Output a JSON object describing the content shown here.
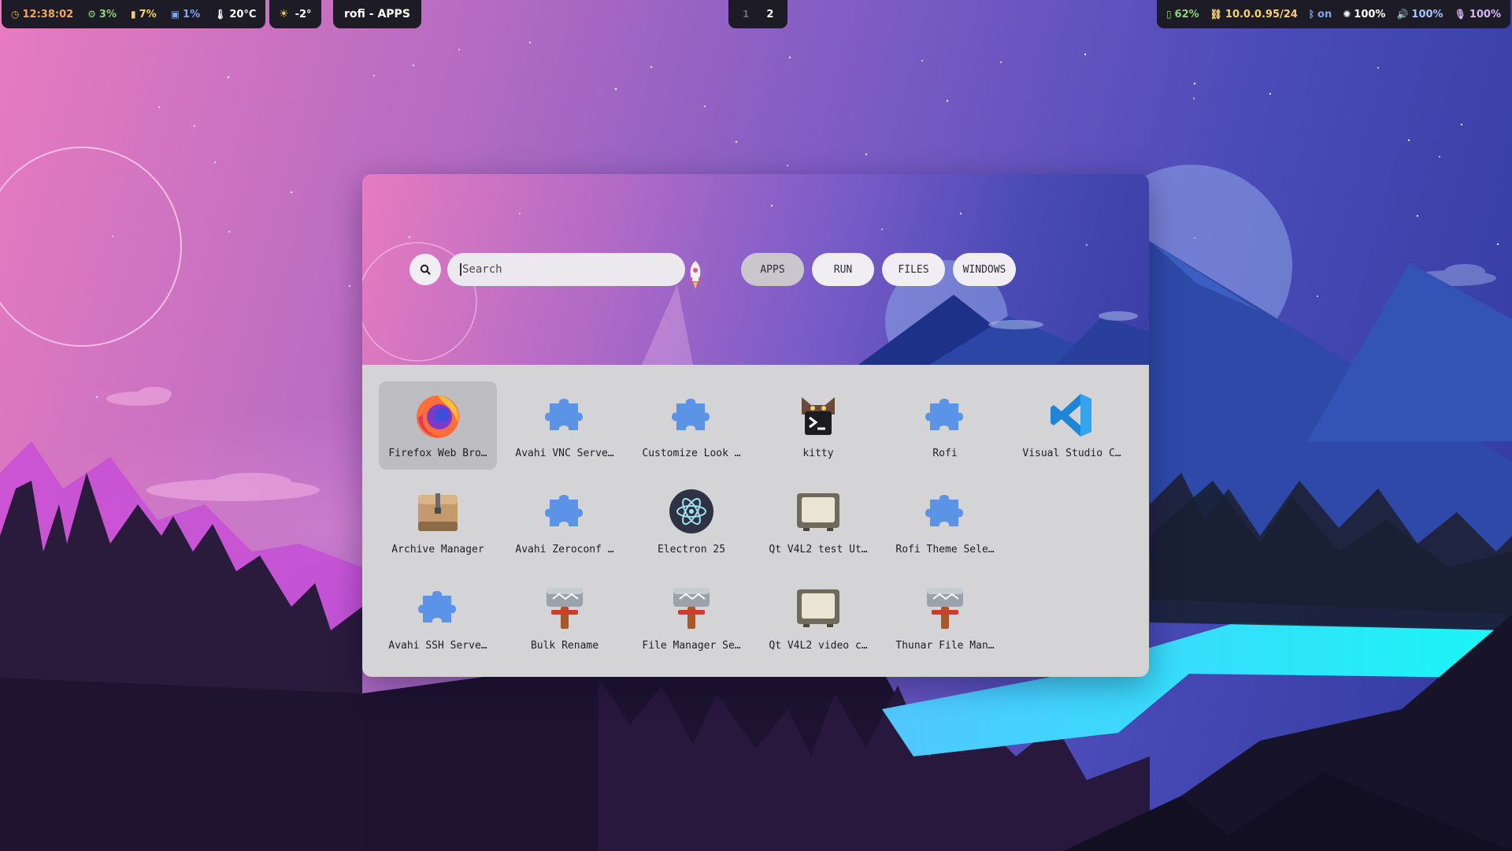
{
  "topbar": {
    "clock": "12:38:02",
    "cpu": "3%",
    "memory": "7%",
    "disk": "1%",
    "temperature": "20°C",
    "weather": "-2°",
    "window_title": "rofi - APPS",
    "workspaces": [
      "1",
      "2"
    ],
    "active_workspace": "2",
    "battery": "62%",
    "network": "10.0.0.95/24",
    "bluetooth": "on",
    "brightness": "100%",
    "volume": "100%",
    "microphone": "100%"
  },
  "rofi": {
    "search": {
      "placeholder": "Search",
      "value": ""
    },
    "modes": [
      {
        "label": "APPS",
        "active": true
      },
      {
        "label": "RUN",
        "active": false
      },
      {
        "label": "FILES",
        "active": false
      },
      {
        "label": "WINDOWS",
        "active": false
      }
    ],
    "apps": [
      {
        "label": "Firefox Web Bro…",
        "icon": "firefox-icon",
        "selected": true
      },
      {
        "label": "Avahi VNC Serve…",
        "icon": "puzzle-icon"
      },
      {
        "label": "Customize Look …",
        "icon": "puzzle-icon"
      },
      {
        "label": "kitty",
        "icon": "kitty-icon"
      },
      {
        "label": "Rofi",
        "icon": "puzzle-icon"
      },
      {
        "label": "Visual Studio C…",
        "icon": "vscode-icon"
      },
      {
        "label": "Archive Manager",
        "icon": "archive-icon"
      },
      {
        "label": "Avahi Zeroconf …",
        "icon": "puzzle-icon"
      },
      {
        "label": "Electron 25",
        "icon": "electron-icon"
      },
      {
        "label": "Qt V4L2 test Ut…",
        "icon": "webcam-icon"
      },
      {
        "label": "Rofi Theme Sele…",
        "icon": "puzzle-icon"
      },
      {
        "label": "Avahi SSH Serve…",
        "icon": "puzzle-icon"
      },
      {
        "label": "Bulk Rename",
        "icon": "thunar-icon"
      },
      {
        "label": "File Manager Se…",
        "icon": "thunar-icon"
      },
      {
        "label": "Qt V4L2 video c…",
        "icon": "webcam-icon"
      },
      {
        "label": "Thunar File Man…",
        "icon": "thunar-icon"
      }
    ]
  },
  "colors": {
    "accent_green": "#8fd37a",
    "accent_orange": "#f2a85c",
    "accent_blue": "#7fa8f0",
    "accent_yellow": "#f5d36a",
    "bar_bg": "#1d1b25",
    "grid_bg": "#d4d3d6",
    "selected_bg": "#bdbcc0"
  }
}
